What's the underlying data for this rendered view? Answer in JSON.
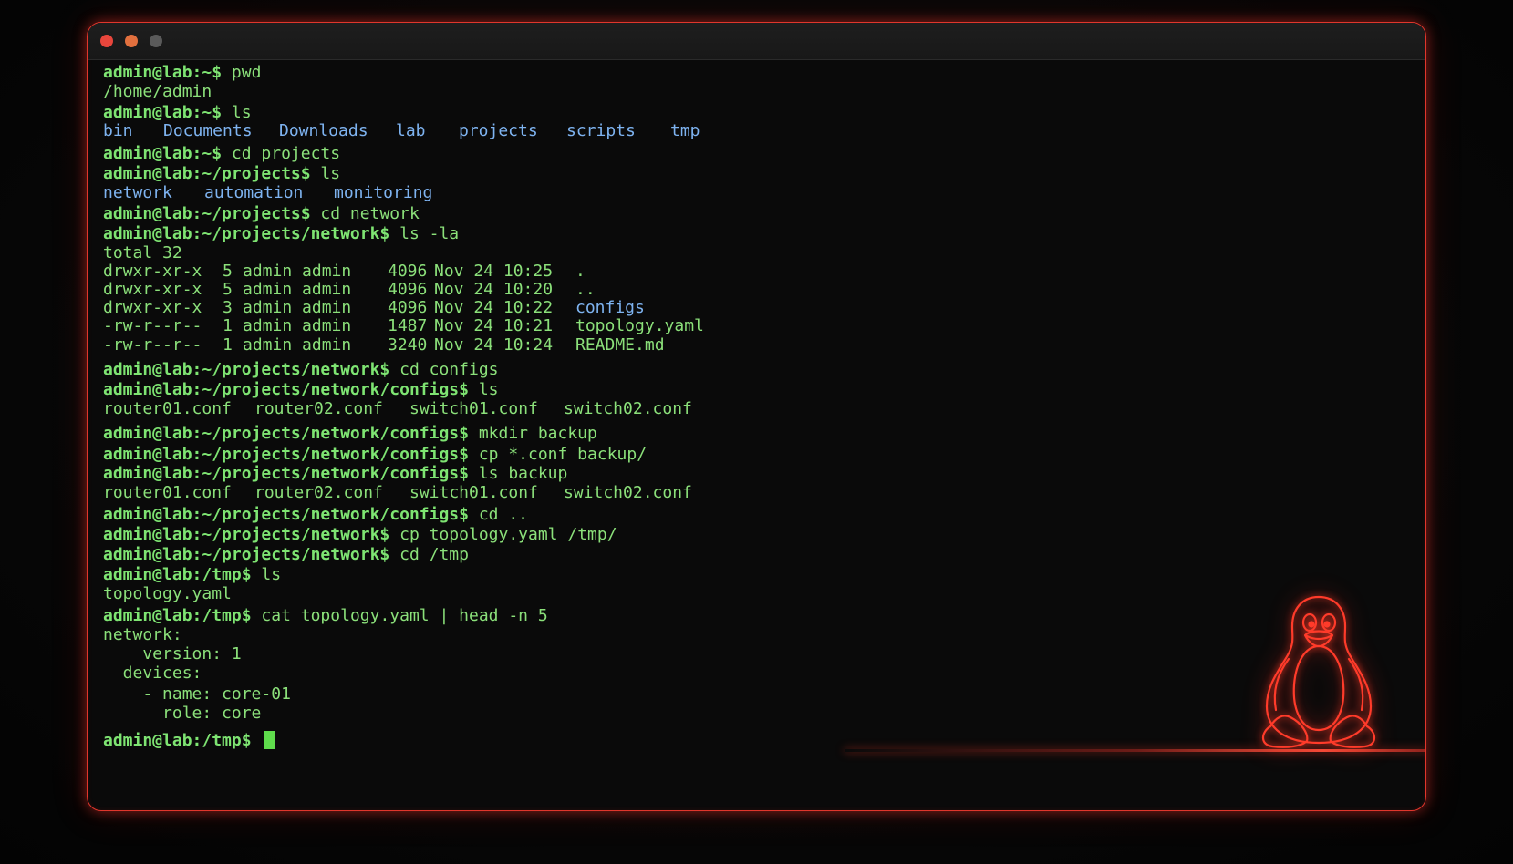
{
  "window": {
    "controls": [
      "close",
      "minimize",
      "maximize"
    ],
    "accent_color": "#e0362c"
  },
  "terminal": {
    "prompt_color": "#7ee472",
    "directory_color": "#7eb3f0",
    "lines": [
      {
        "prompt": "admin@lab:~$",
        "cmd": "pwd"
      },
      {
        "out": "/home/admin"
      },
      {
        "prompt": "admin@lab:~$",
        "cmd": "ls"
      },
      {
        "dirs": [
          "bin",
          "Documents",
          "Downloads",
          "lab",
          "projects",
          "scripts",
          "tmp"
        ]
      },
      {
        "prompt": "admin@lab:~$",
        "cmd": "cd projects"
      },
      {
        "prompt": "admin@lab:~/projects$",
        "cmd": "ls"
      },
      {
        "dirs": [
          "network",
          "automation",
          "monitoring"
        ]
      },
      {
        "prompt": "admin@lab:~/projects$",
        "cmd": "cd network"
      },
      {
        "prompt": "admin@lab:~/projects/network$",
        "cmd": "ls -la"
      },
      {
        "out": "total 32"
      },
      {
        "listing": {
          "perms": "drwxr-xr-x",
          "links": "5",
          "owner": "admin admin",
          "size": "4096",
          "date": "Nov 24 10:25",
          "name": ".",
          "is_dir": true
        }
      },
      {
        "listing": {
          "perms": "drwxr-xr-x",
          "links": "5",
          "owner": "admin admin",
          "size": "4096",
          "date": "Nov 24 10:20",
          "name": "..",
          "is_dir": true
        }
      },
      {
        "listing": {
          "perms": "drwxr-xr-x",
          "links": "3",
          "owner": "admin admin",
          "size": "4096",
          "date": "Nov 24 10:22",
          "name": "configs",
          "is_dir": true
        }
      },
      {
        "listing": {
          "perms": "-rw-r--r--",
          "links": "1",
          "owner": "admin admin",
          "size": "1487",
          "date": "Nov 24 10:21",
          "name": "topology.yaml",
          "is_dir": false
        }
      },
      {
        "listing": {
          "perms": "-rw-r--r--",
          "links": "1",
          "owner": "admin admin",
          "size": "3240",
          "date": "Nov 24 10:24",
          "name": "README.md",
          "is_dir": false
        }
      },
      {
        "prompt": "admin@lab:~/projects/network$",
        "cmd": "cd configs"
      },
      {
        "prompt": "admin@lab:~/projects/network/configs$",
        "cmd": "ls"
      },
      {
        "files": [
          "router01.conf",
          "router02.conf",
          "switch01.conf",
          "switch02.conf"
        ]
      },
      {
        "prompt": "admin@lab:~/projects/network/configs$",
        "cmd": "mkdir backup"
      },
      {
        "prompt": "admin@lab:~/projects/network/configs$",
        "cmd": "cp *.conf backup/"
      },
      {
        "prompt": "admin@lab:~/projects/network/configs$",
        "cmd": "ls backup"
      },
      {
        "files": [
          "router01.conf",
          "router02.conf",
          "switch01.conf",
          "switch02.conf"
        ]
      },
      {
        "prompt": "admin@lab:~/projects/network/configs$",
        "cmd": "cd .."
      },
      {
        "prompt": "admin@lab:~/projects/network$",
        "cmd": "cp topology.yaml /tmp/"
      },
      {
        "prompt": "admin@lab:~/projects/network$",
        "cmd": "cd /tmp"
      },
      {
        "prompt": "admin@lab:/tmp$",
        "cmd": "ls"
      },
      {
        "out": "topology.yaml"
      },
      {
        "prompt": "admin@lab:/tmp$",
        "cmd": "cat topology.yaml | head -n 5"
      },
      {
        "out": "network:"
      },
      {
        "out": "    version: 1"
      },
      {
        "out": "  devices:"
      },
      {
        "out": "    - name: core-01"
      },
      {
        "out": "      role: core"
      },
      {
        "prompt": "admin@lab:/tmp$",
        "cmd": "",
        "cursor": true
      }
    ]
  },
  "decoration": {
    "mascot_icon": "tux-penguin-icon"
  }
}
